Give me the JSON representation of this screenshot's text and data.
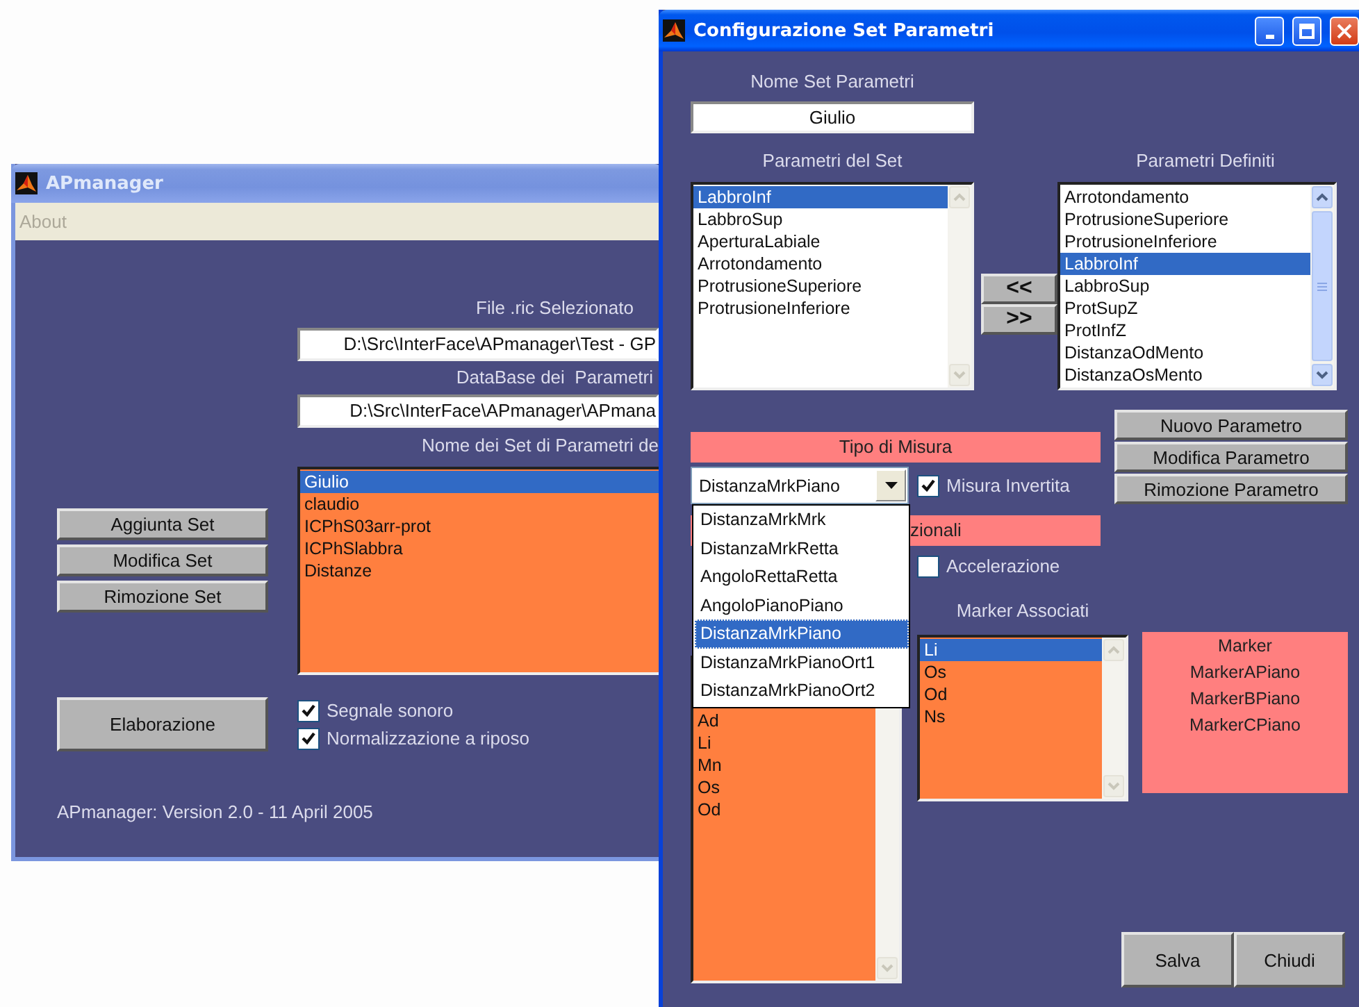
{
  "apmanager": {
    "title": "APmanager",
    "menu": [
      "About"
    ],
    "fields": [
      {
        "label": "File .ric Selezionato",
        "value": "D:\\Src\\InterFace\\APmanager\\Test - GP"
      },
      {
        "label": "DataBase dei  Parametri",
        "value": "D:\\Src\\InterFace\\APmanager\\APmana"
      }
    ],
    "sets_label": "Nome dei Set di Parametri de",
    "sets": [
      {
        "label": "Giulio",
        "selected": true
      },
      {
        "label": "claudio",
        "selected": false
      },
      {
        "label": "ICPhS03arr-prot",
        "selected": false
      },
      {
        "label": "ICPhSlabbra",
        "selected": false
      },
      {
        "label": "Distanze",
        "selected": false
      }
    ],
    "buttons": [
      "Aggiunta Set",
      "Modifica Set",
      "Rimozione Set"
    ],
    "process_button": "Elaborazione",
    "options": [
      {
        "label": "Segnale sonoro",
        "checked": true
      },
      {
        "label": "Normalizzazione a riposo",
        "checked": true
      }
    ],
    "version": "APmanager: Version 2.0 - 11 April 2005"
  },
  "config": {
    "title": "Configurazione Set Parametri",
    "name_label": "Nome Set Parametri",
    "name_value": "Giulio",
    "set_params": {
      "label": "Parametri del Set",
      "items": [
        {
          "label": "LabbroInf",
          "selected": true
        },
        {
          "label": "LabbroSup",
          "selected": false
        },
        {
          "label": "AperturaLabiale",
          "selected": false
        },
        {
          "label": "Arrotondamento",
          "selected": false
        },
        {
          "label": "ProtrusioneSuperiore",
          "selected": false
        },
        {
          "label": "ProtrusioneInferiore",
          "selected": false
        }
      ]
    },
    "defined_params": {
      "label": "Parametri Definiti",
      "items": [
        {
          "label": "Arrotondamento",
          "selected": false
        },
        {
          "label": "ProtrusioneSuperiore",
          "selected": false
        },
        {
          "label": "ProtrusioneInferiore",
          "selected": false
        },
        {
          "label": "LabbroInf",
          "selected": true
        },
        {
          "label": "LabbroSup",
          "selected": false
        },
        {
          "label": "ProtSupZ",
          "selected": false
        },
        {
          "label": "ProtInfZ",
          "selected": false
        },
        {
          "label": "DistanzaOdMento",
          "selected": false
        },
        {
          "label": "DistanzaOsMento",
          "selected": false
        }
      ]
    },
    "move_buttons": [
      "<<",
      ">>"
    ],
    "measure_label": "Tipo di Misura",
    "measure_type": {
      "value": "DistanzaMrkPiano",
      "expanded": true,
      "options": [
        {
          "label": "DistanzaMrkMrk",
          "selected": false
        },
        {
          "label": "DistanzaMrkRetta",
          "selected": false
        },
        {
          "label": "AngoloRettaRetta",
          "selected": false
        },
        {
          "label": "AngoloPianoPiano",
          "selected": false
        },
        {
          "label": "DistanzaMrkPiano",
          "selected": true
        },
        {
          "label": "DistanzaMrkPianoOrt1",
          "selected": false
        },
        {
          "label": "DistanzaMrkPianoOrt2",
          "selected": false
        }
      ]
    },
    "invert": {
      "label": "Misura Invertita",
      "checked": true
    },
    "options_label": "zionali",
    "acceleration": {
      "label": "Accelerazione",
      "checked": false
    },
    "param_buttons": [
      "Nuovo Parametro",
      "Modifica Parametro",
      "Rimozione Parametro"
    ],
    "markers": [
      {
        "label": "Ad",
        "selected": false
      },
      {
        "label": "Li",
        "selected": false
      },
      {
        "label": "Mn",
        "selected": false
      },
      {
        "label": "Os",
        "selected": false
      },
      {
        "label": "Od",
        "selected": false
      }
    ],
    "associated_label": "Marker Associati",
    "associated": [
      {
        "label": "Li",
        "selected": true
      },
      {
        "label": "Os",
        "selected": false
      },
      {
        "label": "Od",
        "selected": false
      },
      {
        "label": "Ns",
        "selected": false
      }
    ],
    "marker_panel": [
      "Marker",
      "MarkerAPiano",
      "MarkerBPiano",
      "MarkerCPiano"
    ],
    "actions": [
      "Salva",
      "Chiudi"
    ]
  }
}
